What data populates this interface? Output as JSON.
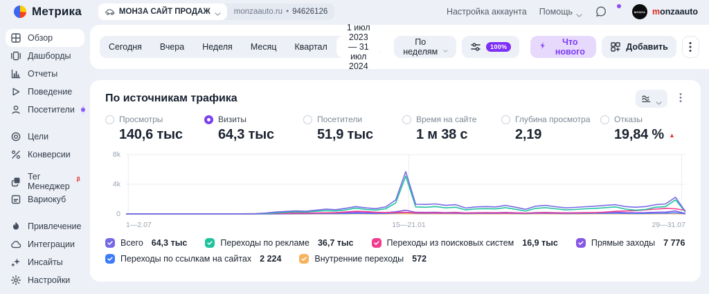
{
  "header": {
    "logo_text": "Метрика",
    "counter": {
      "name": "МОНЗА САЙТ ПРОДАЖ",
      "domain": "monzaauto.ru",
      "separator": "•",
      "id": "94626126"
    },
    "links": {
      "account": "Настройка аккаунта",
      "help": "Помощь"
    },
    "user": {
      "avatar_text": "MONZA",
      "name_first": "m",
      "name_rest": "onzaauto"
    }
  },
  "sidebar": {
    "groups": [
      {
        "items": [
          {
            "label": "Обзор",
            "icon": "overview",
            "active": true
          },
          {
            "label": "Дашборды",
            "icon": "dashboards"
          },
          {
            "label": "Отчеты",
            "icon": "reports"
          },
          {
            "label": "Поведение",
            "icon": "behavior"
          },
          {
            "label": "Посетители",
            "icon": "visitors",
            "dot": true
          }
        ]
      },
      {
        "items": [
          {
            "label": "Цели",
            "icon": "goals"
          },
          {
            "label": "Конверсии",
            "icon": "conversions"
          }
        ]
      },
      {
        "items": [
          {
            "label": "Тег Менеджер",
            "icon": "tag-manager",
            "beta": "β"
          },
          {
            "label": "Вариокуб",
            "icon": "variocube"
          }
        ]
      },
      {
        "items": [
          {
            "label": "Привлечение",
            "icon": "attraction"
          },
          {
            "label": "Интеграции",
            "icon": "integrations"
          },
          {
            "label": "Инсайты",
            "icon": "insights"
          },
          {
            "label": "Настройки",
            "icon": "settings"
          }
        ]
      }
    ]
  },
  "toolbar": {
    "presets": [
      "Сегодня",
      "Вчера",
      "Неделя",
      "Месяц",
      "Квартал"
    ],
    "date_range": "1 июл 2023 — 31 июл 2024",
    "granularity": "По неделям",
    "sampling": "100%",
    "whats_new": "Что нового",
    "add": "Добавить"
  },
  "card": {
    "title": "По источникам трафика",
    "metrics": [
      {
        "label": "Просмотры",
        "value": "140,6 тыс",
        "selected": false
      },
      {
        "label": "Визиты",
        "value": "64,3 тыс",
        "selected": true
      },
      {
        "label": "Посетители",
        "value": "51,9 тыс",
        "selected": false
      },
      {
        "label": "Время на сайте",
        "value": "1 м 38 с",
        "selected": false
      },
      {
        "label": "Глубина просмотра",
        "value": "2,19",
        "selected": false
      },
      {
        "label": "Отказы",
        "value": "19,84 %",
        "selected": false,
        "trend": "up",
        "trend_color": "#e0332c"
      }
    ]
  },
  "chart_data": {
    "type": "line",
    "title": "По источникам трафика — Визиты (по неделям, 1 июл 2023 — 31 июл 2024)",
    "grid": true,
    "legend_position": "bottom",
    "y_axis": {
      "min": 0,
      "max": 8000,
      "ticks": [
        0,
        4000,
        8000
      ],
      "tick_labels": [
        "0",
        "4k",
        "8k"
      ]
    },
    "x_axis": {
      "unit": "weeks",
      "tick_labels": [
        "1—2.07",
        "15—21.01",
        "29—31.07"
      ],
      "tick_fractions": [
        0.004,
        0.5055,
        0.993
      ]
    },
    "legend_rows": [
      4,
      2
    ],
    "series": [
      {
        "name": "Всего",
        "legend_value": "64,3 тыс",
        "color": "#7569e6",
        "values": [
          15,
          18,
          14,
          16,
          15,
          17,
          16,
          18,
          15,
          17,
          19,
          22,
          28,
          45,
          120,
          260,
          340,
          410,
          370,
          500,
          640,
          580,
          760,
          1000,
          820,
          720,
          950,
          1900,
          5700,
          1300,
          1280,
          1350,
          1150,
          1250,
          800,
          950,
          1000,
          950,
          1150,
          900,
          620,
          1050,
          1150,
          980,
          820,
          880,
          980,
          1050,
          1150,
          1250,
          1000,
          900,
          1000,
          1250,
          1350,
          2250,
          320
        ]
      },
      {
        "name": "Переходы по рекламе",
        "legend_value": "36,7 тыс",
        "color": "#1fc39e",
        "values": [
          6,
          8,
          7,
          8,
          7,
          9,
          8,
          9,
          7,
          8,
          10,
          12,
          15,
          25,
          60,
          150,
          220,
          280,
          250,
          350,
          450,
          400,
          550,
          780,
          600,
          520,
          700,
          1500,
          5100,
          950,
          900,
          1000,
          820,
          900,
          550,
          680,
          720,
          680,
          850,
          620,
          380,
          750,
          850,
          700,
          550,
          600,
          700,
          750,
          850,
          950,
          650,
          500,
          600,
          900,
          1000,
          1900,
          250
        ]
      },
      {
        "name": "Переходы из поисковых систем",
        "legend_value": "16,9 тыс",
        "color": "#f23d8f",
        "values": [
          4,
          5,
          4,
          5,
          4,
          5,
          5,
          6,
          5,
          5,
          6,
          8,
          10,
          15,
          40,
          80,
          100,
          120,
          110,
          140,
          160,
          180,
          280,
          350,
          320,
          220,
          180,
          200,
          220,
          150,
          140,
          150,
          140,
          150,
          120,
          130,
          140,
          130,
          150,
          130,
          110,
          140,
          150,
          130,
          120,
          130,
          150,
          180,
          250,
          350,
          400,
          450,
          550,
          650,
          750,
          700,
          480
        ]
      },
      {
        "name": "Прямые заходы",
        "legend_value": "7 776",
        "color": "#8657e5",
        "values": [
          3,
          3,
          3,
          3,
          3,
          4,
          3,
          4,
          3,
          3,
          4,
          5,
          6,
          10,
          25,
          50,
          70,
          90,
          80,
          110,
          130,
          120,
          160,
          200,
          170,
          150,
          190,
          300,
          500,
          220,
          210,
          220,
          190,
          210,
          140,
          170,
          180,
          170,
          200,
          160,
          110,
          190,
          200,
          170,
          150,
          160,
          180,
          190,
          210,
          230,
          180,
          160,
          180,
          230,
          250,
          400,
          60
        ]
      },
      {
        "name": "Переходы по ссылкам на сайтах",
        "legend_value": "2 224",
        "color": "#3e7bfa",
        "values": [
          2,
          2,
          2,
          2,
          2,
          2,
          2,
          2,
          2,
          2,
          3,
          3,
          4,
          5,
          10,
          20,
          30,
          40,
          35,
          45,
          55,
          50,
          65,
          80,
          70,
          60,
          75,
          120,
          200,
          90,
          85,
          90,
          80,
          85,
          55,
          70,
          75,
          70,
          85,
          65,
          45,
          80,
          85,
          70,
          60,
          65,
          75,
          80,
          85,
          95,
          75,
          65,
          75,
          95,
          100,
          160,
          25
        ]
      },
      {
        "name": "Внутренние переходы",
        "legend_value": "572",
        "color": "#f6b25e",
        "values": [
          1,
          1,
          1,
          1,
          1,
          1,
          1,
          1,
          1,
          1,
          1,
          2,
          2,
          3,
          5,
          8,
          10,
          12,
          11,
          14,
          16,
          15,
          19,
          25,
          21,
          18,
          22,
          35,
          60,
          27,
          26,
          27,
          24,
          26,
          17,
          21,
          22,
          21,
          26,
          20,
          14,
          24,
          26,
          21,
          18,
          20,
          22,
          24,
          26,
          29,
          22,
          20,
          22,
          29,
          31,
          48,
          8
        ]
      }
    ]
  }
}
